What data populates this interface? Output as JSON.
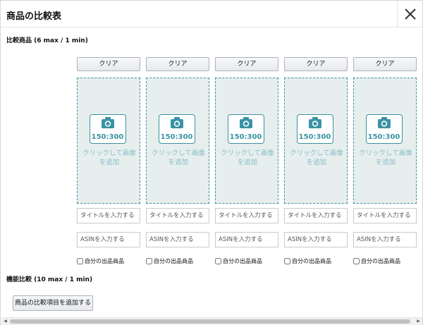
{
  "dialog": {
    "title": "商品の比較表",
    "close_icon": "close-icon"
  },
  "products_section": {
    "label": "比較商品 (6 max / 1 min)"
  },
  "columns": [
    {
      "clear_label": "クリア",
      "image_size": "150:300",
      "add_image_text": "クリックして画像\nを追加",
      "title_placeholder": "タイトルを入力する",
      "asin_placeholder": "ASINを入力する",
      "own_product_label": "自分の出品商品"
    },
    {
      "clear_label": "クリア",
      "image_size": "150:300",
      "add_image_text": "クリックして画像\nを追加",
      "title_placeholder": "タイトルを入力する",
      "asin_placeholder": "ASINを入力する",
      "own_product_label": "自分の出品商品"
    },
    {
      "clear_label": "クリア",
      "image_size": "150:300",
      "add_image_text": "クリックして画像\nを追加",
      "title_placeholder": "タイトルを入力する",
      "asin_placeholder": "ASINを入力する",
      "own_product_label": "自分の出品商品"
    },
    {
      "clear_label": "クリア",
      "image_size": "150:300",
      "add_image_text": "クリックして画像\nを追加",
      "title_placeholder": "タイトルを入力する",
      "asin_placeholder": "ASINを入力する",
      "own_product_label": "自分の出品商品"
    },
    {
      "clear_label": "クリア",
      "image_size": "150:300",
      "add_image_text": "クリックして画像\nを追加",
      "title_placeholder": "タイトルを入力する",
      "asin_placeholder": "ASINを入力する",
      "own_product_label": "自分の出品商品"
    }
  ],
  "features_section": {
    "label": "機能比較 (10 max / 1 min)",
    "add_button_label": "商品の比較項目を追加する"
  },
  "icons": {
    "camera": "camera-icon",
    "scroll_left": "scroll-left-arrow-icon",
    "scroll_right": "scroll-right-arrow-icon"
  },
  "colors": {
    "accent": "#3a93a3",
    "drop_zone_bg": "#e7eeee",
    "add_image_text": "#86bec8"
  }
}
